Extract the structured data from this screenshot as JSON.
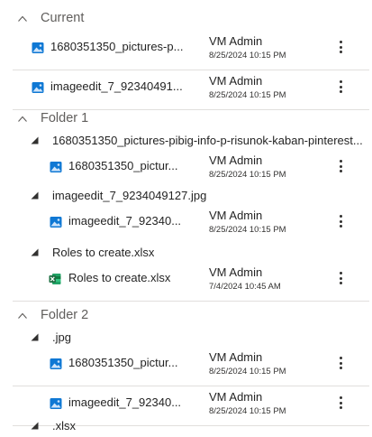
{
  "sections": [
    {
      "title": "Current",
      "files": [
        {
          "name": "1680351350_pictures-p...",
          "owner": "VM Admin",
          "date": "8/25/2024 10:15 PM",
          "icon": "image-icon"
        },
        {
          "name": "imageedit_7_92340491...",
          "owner": "VM Admin",
          "date": "8/25/2024 10:15 PM",
          "icon": "image-icon"
        }
      ]
    },
    {
      "title": "Folder 1",
      "groups": [
        {
          "label": "1680351350_pictures-pibig-info-p-risunok-kaban-pinterest...",
          "file": {
            "name": "1680351350_pictur...",
            "owner": "VM Admin",
            "date": "8/25/2024 10:15 PM",
            "icon": "image-icon"
          }
        },
        {
          "label": "imageedit_7_9234049127.jpg",
          "file": {
            "name": "imageedit_7_92340...",
            "owner": "VM Admin",
            "date": "8/25/2024 10:15 PM",
            "icon": "image-icon"
          }
        },
        {
          "label": "Roles to create.xlsx",
          "file": {
            "name": "Roles to create.xlsx",
            "owner": "VM Admin",
            "date": "7/4/2024 10:45 AM",
            "icon": "excel-icon"
          }
        }
      ]
    },
    {
      "title": "Folder 2",
      "groups": [
        {
          "label": ".jpg",
          "files": [
            {
              "name": "1680351350_pictur...",
              "owner": "VM Admin",
              "date": "8/25/2024 10:15 PM",
              "icon": "image-icon"
            },
            {
              "name": "imageedit_7_92340...",
              "owner": "VM Admin",
              "date": "8/25/2024 10:15 PM",
              "icon": "image-icon"
            }
          ]
        },
        {
          "label": ".xlsx"
        }
      ]
    }
  ],
  "colors": {
    "image_icon": "#0f78d4",
    "excel_icon": "#1d6f42",
    "header_text": "#605e5c",
    "divider": "#e1dfdd"
  }
}
